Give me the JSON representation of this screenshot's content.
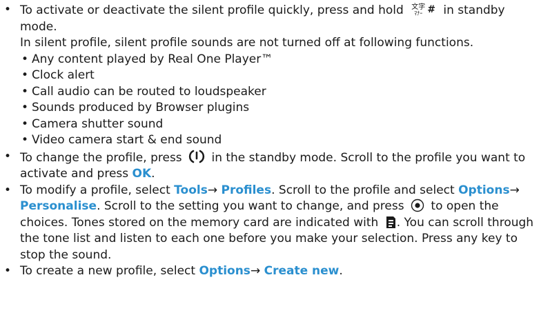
{
  "silent": {
    "line1_a": "To activate or deactivate the silent profile quickly, press and hold",
    "key_label_a": "文字",
    "key_label_b": "ﾏﾅｰ",
    "key_symbol": "#",
    "line1_b": "in standby mode.",
    "note": "In silent profile,  silent profile sounds are not turned off at following functions.",
    "exceptions": [
      "Any content played by Real One Player™",
      "Clock alert",
      "Call audio can be routed to loudspeaker",
      "Sounds produced by Browser plugins",
      "Camera shutter sound",
      "Video camera start & end sound"
    ]
  },
  "change": {
    "text_a": "To change the profile, press",
    "text_b": "in the standby mode. Scroll to the profile you want to activate and press",
    "ok": "OK",
    "end": "."
  },
  "modify": {
    "text_a": "To modify a profile, select",
    "tools": "Tools",
    "arrow": "→",
    "profiles": "Profiles",
    "text_b": ". Scroll to the profile and select",
    "options": "Options",
    "personalise": "Personalise",
    "text_c": ". Scroll to the setting you want to change, and press",
    "text_d": "to open the choices. Tones stored on the memory card are indicated with",
    "text_e": ". You can scroll through the tone list and listen to each one before you make your selection. Press any key to stop the sound."
  },
  "create": {
    "text_a": "To create a new profile, select",
    "options": "Options",
    "arrow": "→",
    "create_new": "Create new",
    "end": "."
  },
  "bullet_char": "•"
}
